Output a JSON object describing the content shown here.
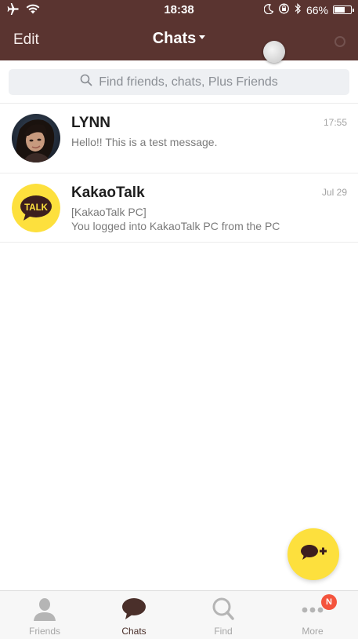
{
  "status_bar": {
    "time": "18:38",
    "battery_text": "66%",
    "battery_level": 0.66,
    "icons": [
      "airplane-icon",
      "wifi-icon",
      "moon-icon",
      "orientation-lock-icon",
      "bluetooth-icon",
      "battery-icon"
    ]
  },
  "nav": {
    "edit_label": "Edit",
    "title": "Chats"
  },
  "search": {
    "placeholder": "Find friends, chats, Plus Friends"
  },
  "chats": [
    {
      "name": "LYNN",
      "time": "17:55",
      "message": "Hello!! This is a test message.",
      "avatar": "profile-photo"
    },
    {
      "name": "KakaoTalk",
      "time": "Jul 29",
      "message_line1": "[KakaoTalk PC]",
      "message_line2": "You logged into KakaoTalk PC from the PC",
      "avatar_text": "TALK"
    }
  ],
  "tabs": [
    {
      "label": "Friends",
      "icon": "person-icon",
      "active": false
    },
    {
      "label": "Chats",
      "icon": "chat-bubble-icon",
      "active": true
    },
    {
      "label": "Find",
      "icon": "search-icon",
      "active": false
    },
    {
      "label": "More",
      "icon": "more-dots-icon",
      "active": false
    }
  ],
  "more_badge": "N",
  "colors": {
    "header_bg": "#5a3430",
    "fab_bg": "#fde03d",
    "badge_bg": "#f4543d",
    "kakao_yellow": "#fde03d"
  }
}
